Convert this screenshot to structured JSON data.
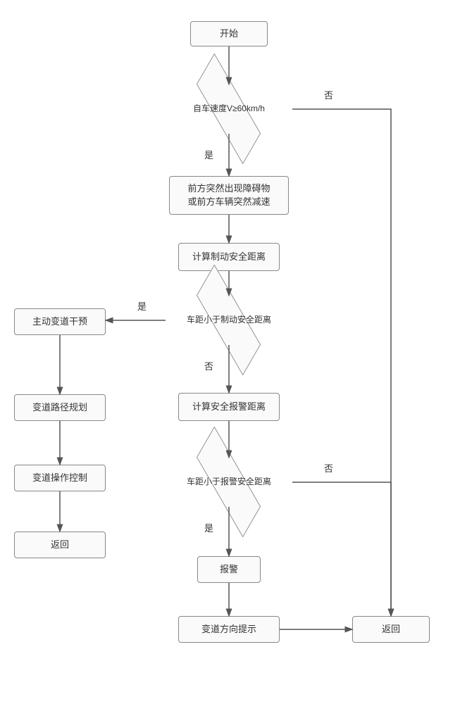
{
  "nodes": {
    "start": "开始",
    "d1": "自车速度V≥60km/h",
    "obstacle": "前方突然出现障碍物\n或前方车辆突然减速",
    "calc_brake": "计算制动安全距离",
    "d2": "车距小于制动安全距离",
    "active_lane": "主动变道干预",
    "lane_plan": "变道路径规划",
    "lane_ctrl": "变道操作控制",
    "return_left": "返回",
    "calc_alarm": "计算安全报警距离",
    "d3": "车距小于报警安全距离",
    "alarm": "报警",
    "lane_hint": "变道方向提示",
    "return_right": "返回"
  },
  "labels": {
    "yes": "是",
    "no": "否"
  }
}
